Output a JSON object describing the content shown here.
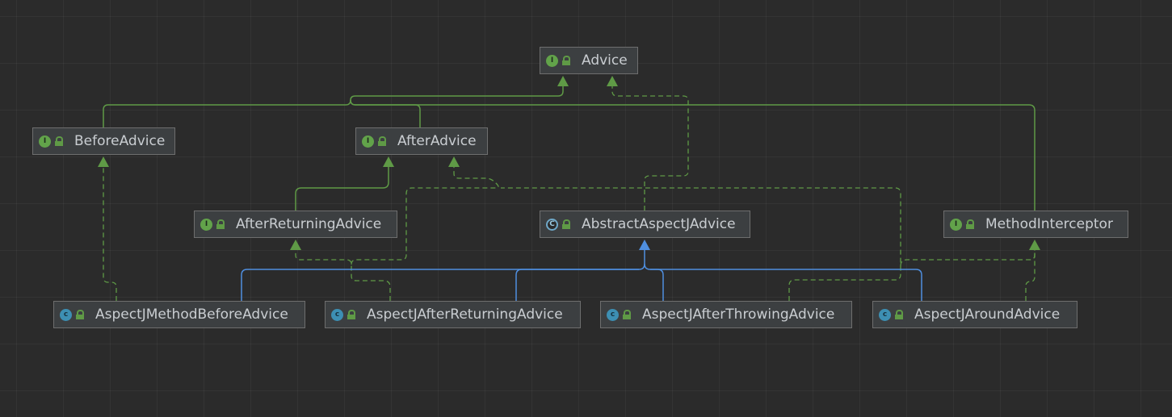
{
  "colors": {
    "background": "#2b2b2b",
    "node_fill": "#3c3f41",
    "node_border": "#6e6e6e",
    "text": "#c9cdd1",
    "extends_edge": "#4f8fe0",
    "implements_edge": "#5f9a46"
  },
  "nodes": {
    "advice": {
      "label": "Advice",
      "kind": "interface",
      "icon": "interface-icon"
    },
    "before_advice": {
      "label": "BeforeAdvice",
      "kind": "interface",
      "icon": "interface-icon"
    },
    "after_advice": {
      "label": "AfterAdvice",
      "kind": "interface",
      "icon": "interface-icon"
    },
    "after_returning_advice": {
      "label": "AfterReturningAdvice",
      "kind": "interface",
      "icon": "interface-icon"
    },
    "abstract_aspectj_advice": {
      "label": "AbstractAspectJAdvice",
      "kind": "abstract",
      "icon": "abstract-class-icon"
    },
    "method_interceptor": {
      "label": "MethodInterceptor",
      "kind": "interface",
      "icon": "interface-icon"
    },
    "aspectj_method_before_advice": {
      "label": "AspectJMethodBeforeAdvice",
      "kind": "class",
      "icon": "class-icon"
    },
    "aspectj_after_returning_advice": {
      "label": "AspectJAfterReturningAdvice",
      "kind": "class",
      "icon": "class-icon"
    },
    "aspectj_after_throwing_advice": {
      "label": "AspectJAfterThrowingAdvice",
      "kind": "class",
      "icon": "class-icon"
    },
    "aspectj_around_advice": {
      "label": "AspectJAroundAdvice",
      "kind": "class",
      "icon": "class-icon"
    }
  },
  "edges": [
    {
      "from": "BeforeAdvice",
      "to": "Advice",
      "type": "extends-interface"
    },
    {
      "from": "AfterAdvice",
      "to": "Advice",
      "type": "extends-interface"
    },
    {
      "from": "MethodInterceptor",
      "to": "Advice",
      "type": "extends-interface"
    },
    {
      "from": "AbstractAspectJAdvice",
      "to": "Advice",
      "type": "implements"
    },
    {
      "from": "AfterReturningAdvice",
      "to": "AfterAdvice",
      "type": "extends-interface"
    },
    {
      "from": "AspectJMethodBeforeAdvice",
      "to": "BeforeAdvice",
      "type": "implements"
    },
    {
      "from": "AspectJAfterReturningAdvice",
      "to": "AfterReturningAdvice",
      "type": "implements"
    },
    {
      "from": "AspectJAfterReturningAdvice",
      "to": "AfterAdvice",
      "type": "implements"
    },
    {
      "from": "AspectJAfterThrowingAdvice",
      "to": "AfterAdvice",
      "type": "implements"
    },
    {
      "from": "AspectJAfterThrowingAdvice",
      "to": "MethodInterceptor",
      "type": "implements"
    },
    {
      "from": "AspectJAroundAdvice",
      "to": "MethodInterceptor",
      "type": "implements"
    },
    {
      "from": "AspectJMethodBeforeAdvice",
      "to": "AbstractAspectJAdvice",
      "type": "extends"
    },
    {
      "from": "AspectJAfterReturningAdvice",
      "to": "AbstractAspectJAdvice",
      "type": "extends"
    },
    {
      "from": "AspectJAfterThrowingAdvice",
      "to": "AbstractAspectJAdvice",
      "type": "extends"
    },
    {
      "from": "AspectJAroundAdvice",
      "to": "AbstractAspectJAdvice",
      "type": "extends"
    }
  ]
}
